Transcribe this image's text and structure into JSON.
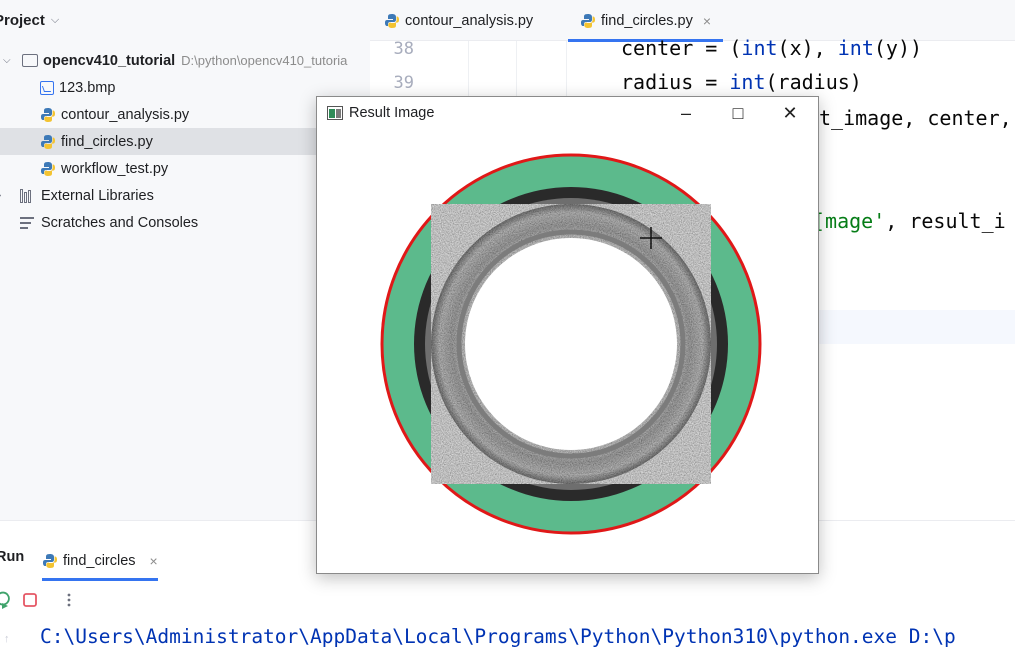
{
  "project": {
    "title": "Project",
    "tree": [
      {
        "label": "opencv410_tutorial",
        "hint": "D:\\python\\opencv410_tutoria"
      },
      {
        "label": "123.bmp"
      },
      {
        "label": "contour_analysis.py"
      },
      {
        "label": "find_circles.py"
      },
      {
        "label": "workflow_test.py"
      },
      {
        "label": "External Libraries"
      },
      {
        "label": "Scratches and Consoles"
      }
    ]
  },
  "editor": {
    "tabs": [
      {
        "label": "contour_analysis.py"
      },
      {
        "label": "find_circles.py",
        "close": "×"
      }
    ],
    "line_numbers": [
      "38",
      "39"
    ],
    "code": {
      "l38": {
        "a": "center = (",
        "b": "int",
        "c": "(x), ",
        "d": "int",
        "e": "(y))"
      },
      "l39": {
        "a": "radius = ",
        "b": "int",
        "c": "(radius)"
      },
      "l40": "t_image, center,",
      "l43": {
        "a": "[mage'",
        "b": ", result_i"
      }
    }
  },
  "run": {
    "label": "Run",
    "tab_label": "find_circles",
    "tab_close": "×",
    "console_line": "C:\\Users\\Administrator\\AppData\\Local\\Programs\\Python\\Python310\\python.exe D:\\p"
  },
  "result_window": {
    "title": "Result Image",
    "minimize": "–",
    "maximize": "□",
    "close": "✕"
  },
  "colors": {
    "accent": "#3574f0",
    "ring_green": "#5cba8c",
    "circle_red": "#e01818",
    "python_blue": "#3d79b7",
    "python_yellow": "#f3c331"
  },
  "icons": {
    "python_file": "python-icon",
    "folder": "folder-icon",
    "image_file": "image-file-icon",
    "libraries": "library-icon",
    "scratches": "scratches-icon"
  }
}
